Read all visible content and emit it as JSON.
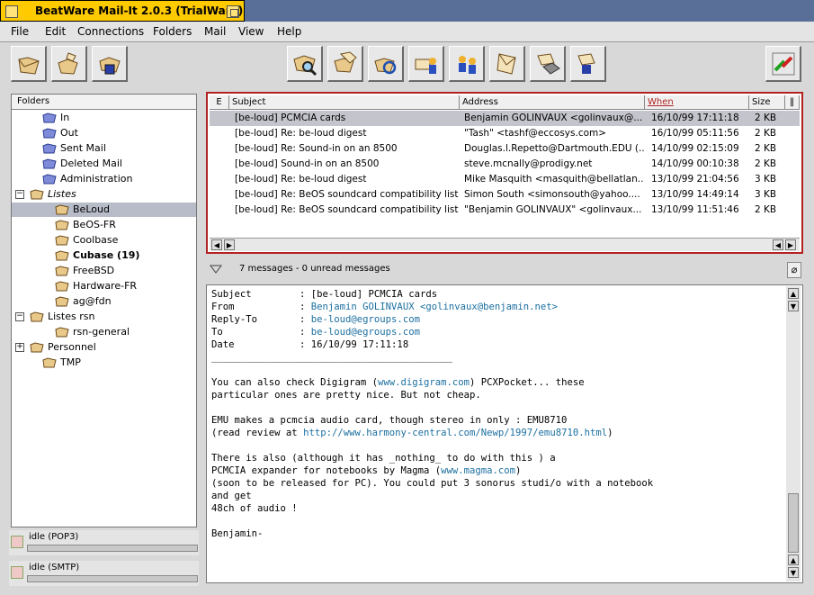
{
  "window": {
    "title": "BeatWare Mail-It 2.0.3 (TrialWare)"
  },
  "menubar": [
    "File",
    "Edit",
    "Connections",
    "Folders",
    "Mail",
    "View",
    "Help"
  ],
  "toolbar": {
    "left": [
      "open-folder-icon",
      "folder-actions-icon",
      "folder-save-icon"
    ],
    "center": [
      "search-mail-icon",
      "folders-icon",
      "refresh-icon",
      "send-receive-icon",
      "forward-icon",
      "mail-icon",
      "erase-icon",
      "filter-icon"
    ],
    "right": [
      "quit-icon"
    ]
  },
  "folders": {
    "header": "Folders",
    "items": [
      {
        "label": "In",
        "level": 1,
        "style": "normal"
      },
      {
        "label": "Out",
        "level": 1,
        "style": "normal"
      },
      {
        "label": "Sent Mail",
        "level": 1,
        "style": "normal"
      },
      {
        "label": "Deleted Mail",
        "level": 1,
        "style": "normal"
      },
      {
        "label": "Administration",
        "level": 1,
        "style": "normal"
      },
      {
        "label": "Listes",
        "level": 0,
        "style": "italic",
        "expander": "−"
      },
      {
        "label": "BeLoud",
        "level": 2,
        "style": "normal",
        "selected": true
      },
      {
        "label": "BeOS-FR",
        "level": 2,
        "style": "normal"
      },
      {
        "label": "Coolbase",
        "level": 2,
        "style": "normal"
      },
      {
        "label": "Cubase (19)",
        "level": 2,
        "style": "bold"
      },
      {
        "label": "FreeBSD",
        "level": 2,
        "style": "normal"
      },
      {
        "label": "Hardware-FR",
        "level": 2,
        "style": "normal"
      },
      {
        "label": "ag@fdn",
        "level": 2,
        "style": "normal"
      },
      {
        "label": "Listes rsn",
        "level": 0,
        "style": "normal",
        "expander": "−"
      },
      {
        "label": "rsn-general",
        "level": 2,
        "style": "normal"
      },
      {
        "label": "Personnel",
        "level": 0,
        "style": "normal",
        "expander": "+"
      },
      {
        "label": "TMP",
        "level": 1,
        "style": "normal"
      }
    ]
  },
  "status": [
    {
      "text": "idle (POP3)"
    },
    {
      "text": "idle (SMTP)"
    }
  ],
  "message_list": {
    "columns": [
      "E",
      "Subject",
      "Address",
      "When",
      "Size"
    ],
    "rows": [
      {
        "subject": "[be-loud] PCMCIA cards",
        "address": "Benjamin GOLINVAUX <golinvaux@...",
        "when": "16/10/99 17:11:18",
        "size": "2 KB",
        "selected": true
      },
      {
        "subject": "[be-loud] Re: be-loud digest",
        "address": "\"Tash\" <tashf@eccosys.com>",
        "when": "16/10/99 05:11:56",
        "size": "2 KB"
      },
      {
        "subject": "[be-loud] Re: Sound-in on an 8500",
        "address": "Douglas.l.Repetto@Dartmouth.EDU (...",
        "when": "14/10/99 02:15:09",
        "size": "2 KB"
      },
      {
        "subject": "[be-loud] Sound-in on an 8500",
        "address": "steve.mcnally@prodigy.net",
        "when": "14/10/99 00:10:38",
        "size": "2 KB"
      },
      {
        "subject": "[be-loud] Re: be-loud digest",
        "address": "Mike Masquith <masquith@bellatlan...",
        "when": "13/10/99 21:04:56",
        "size": "3 KB"
      },
      {
        "subject": "[be-loud] Re: BeOS soundcard compatibility list",
        "address": "Simon South <simonsouth@yahoo....",
        "when": "13/10/99 14:49:14",
        "size": "3 KB"
      },
      {
        "subject": "[be-loud] Re: BeOS soundcard compatibility list",
        "address": "\"Benjamin GOLINVAUX\" <golinvaux...",
        "when": "13/10/99 11:51:46",
        "size": "2 KB"
      }
    ]
  },
  "summary": "7 messages - 0 unread messages",
  "message": {
    "headers": [
      {
        "label": "Subject",
        "value": "[be-loud] PCMCIA cards",
        "link": false
      },
      {
        "label": "From",
        "value": "Benjamin GOLINVAUX <golinvaux@benjamin.net>",
        "link": true
      },
      {
        "label": "Reply-To",
        "value": "be-loud@egroups.com",
        "link": true
      },
      {
        "label": "To",
        "value": "be-loud@egroups.com",
        "link": true
      },
      {
        "label": "Date",
        "value": "16/10/99 17:11:18",
        "link": false
      }
    ],
    "separator": "__________________________________________",
    "body": [
      {
        "pre": "You can also check Digigram (",
        "link": "www.digigram.com",
        "post": ") PCXPocket... these"
      },
      {
        "pre": "particular ones are pretty nice. But not cheap.",
        "link": "",
        "post": ""
      },
      {
        "pre": "",
        "link": "",
        "post": ""
      },
      {
        "pre": "EMU makes a pcmcia audio card, though stereo in only : EMU8710",
        "link": "",
        "post": ""
      },
      {
        "pre": "(read review at ",
        "link": "http://www.harmony-central.com/Newp/1997/emu8710.html",
        "post": ")"
      },
      {
        "pre": "",
        "link": "",
        "post": ""
      },
      {
        "pre": "There is also (although it has _nothing_ to do with this ) a",
        "link": "",
        "post": ""
      },
      {
        "pre": "PCMCIA expander for notebooks by Magma (",
        "link": "www.magma.com",
        "post": ")"
      },
      {
        "pre": "(soon to be released for PC). You could put 3 sonorus studi/o with a notebook",
        "link": "",
        "post": ""
      },
      {
        "pre": "and get",
        "link": "",
        "post": ""
      },
      {
        "pre": "48ch of audio !",
        "link": "",
        "post": ""
      },
      {
        "pre": "",
        "link": "",
        "post": ""
      },
      {
        "pre": "Benjamin-",
        "link": "",
        "post": ""
      }
    ]
  },
  "colors": {
    "titlebar": "#ffcb00",
    "list_border": "#b22222",
    "link": "#1c6fa0",
    "selection": "#c4c4cc",
    "desktop": "#5a6f98"
  }
}
